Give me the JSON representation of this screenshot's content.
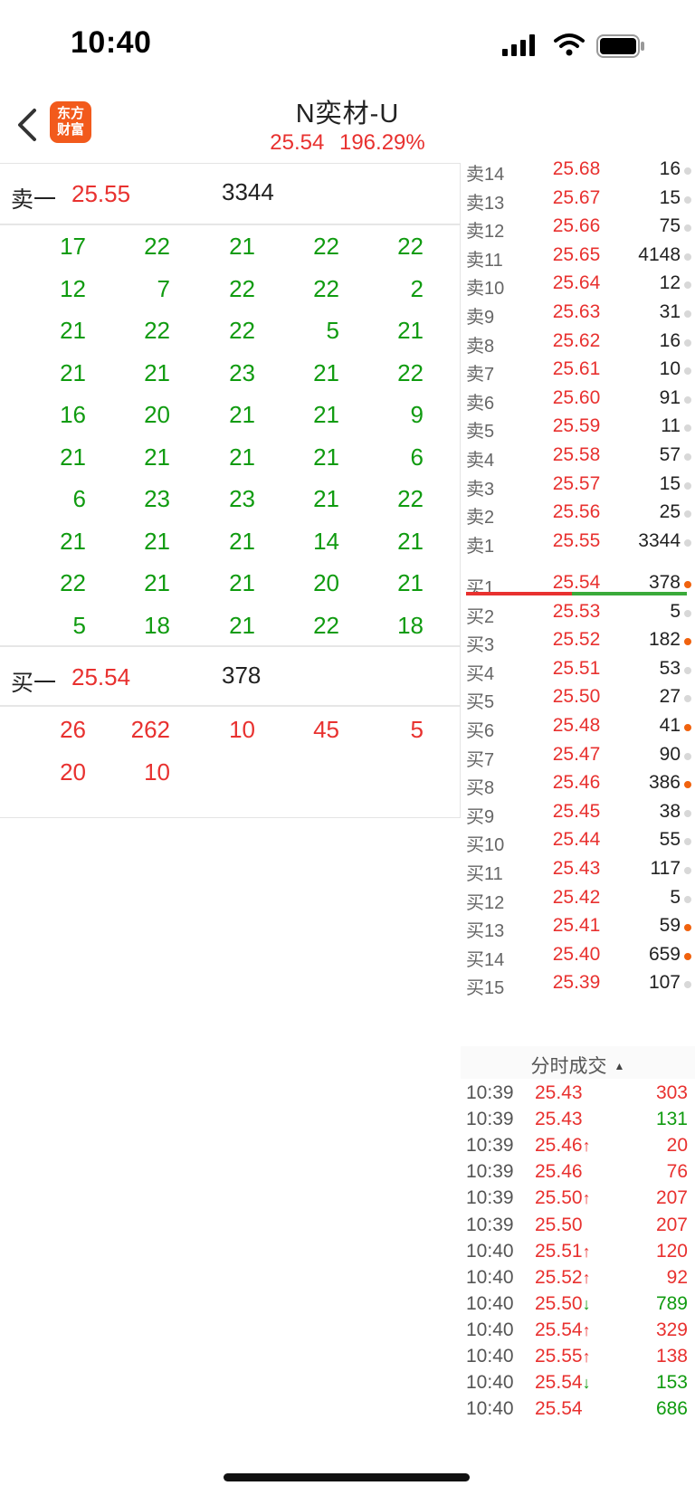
{
  "status_bar": {
    "time": "10:40"
  },
  "header": {
    "logo_line1": "东方",
    "logo_line2": "财富",
    "title": "N奕材-U",
    "price": "25.54",
    "change_pct": "196.29%"
  },
  "sell1": {
    "label": "卖一",
    "price": "25.55",
    "volume": "3344",
    "queue": [
      [
        "17",
        "22",
        "21",
        "22",
        "22"
      ],
      [
        "12",
        "7",
        "22",
        "22",
        "2"
      ],
      [
        "21",
        "22",
        "22",
        "5",
        "21"
      ],
      [
        "21",
        "21",
        "23",
        "21",
        "22"
      ],
      [
        "16",
        "20",
        "21",
        "21",
        "9"
      ],
      [
        "21",
        "21",
        "21",
        "21",
        "6"
      ],
      [
        "6",
        "23",
        "23",
        "21",
        "22"
      ],
      [
        "21",
        "21",
        "21",
        "14",
        "21"
      ],
      [
        "22",
        "21",
        "21",
        "20",
        "21"
      ],
      [
        "5",
        "18",
        "21",
        "22",
        "18"
      ]
    ]
  },
  "buy1": {
    "label": "买一",
    "price": "25.54",
    "volume": "378",
    "queue": [
      [
        "26",
        "262",
        "10",
        "45",
        "5"
      ],
      [
        "20",
        "10"
      ]
    ]
  },
  "order_book": {
    "asks": [
      {
        "label": "卖14",
        "price": "25.68",
        "volume": "16",
        "hot": false
      },
      {
        "label": "卖13",
        "price": "25.67",
        "volume": "15",
        "hot": false
      },
      {
        "label": "卖12",
        "price": "25.66",
        "volume": "75",
        "hot": false
      },
      {
        "label": "卖11",
        "price": "25.65",
        "volume": "4148",
        "hot": false
      },
      {
        "label": "卖10",
        "price": "25.64",
        "volume": "12",
        "hot": false
      },
      {
        "label": "卖9",
        "price": "25.63",
        "volume": "31",
        "hot": false
      },
      {
        "label": "卖8",
        "price": "25.62",
        "volume": "16",
        "hot": false
      },
      {
        "label": "卖7",
        "price": "25.61",
        "volume": "10",
        "hot": false
      },
      {
        "label": "卖6",
        "price": "25.60",
        "volume": "91",
        "hot": false
      },
      {
        "label": "卖5",
        "price": "25.59",
        "volume": "11",
        "hot": false
      },
      {
        "label": "卖4",
        "price": "25.58",
        "volume": "57",
        "hot": false
      },
      {
        "label": "卖3",
        "price": "25.57",
        "volume": "15",
        "hot": false
      },
      {
        "label": "卖2",
        "price": "25.56",
        "volume": "25",
        "hot": false
      },
      {
        "label": "卖1",
        "price": "25.55",
        "volume": "3344",
        "hot": false
      }
    ],
    "bids": [
      {
        "label": "买1",
        "price": "25.54",
        "volume": "378",
        "hot": true
      },
      {
        "label": "买2",
        "price": "25.53",
        "volume": "5",
        "hot": false
      },
      {
        "label": "买3",
        "price": "25.52",
        "volume": "182",
        "hot": true
      },
      {
        "label": "买4",
        "price": "25.51",
        "volume": "53",
        "hot": false
      },
      {
        "label": "买5",
        "price": "25.50",
        "volume": "27",
        "hot": false
      },
      {
        "label": "买6",
        "price": "25.48",
        "volume": "41",
        "hot": true
      },
      {
        "label": "买7",
        "price": "25.47",
        "volume": "90",
        "hot": false
      },
      {
        "label": "买8",
        "price": "25.46",
        "volume": "386",
        "hot": true
      },
      {
        "label": "买9",
        "price": "25.45",
        "volume": "38",
        "hot": false
      },
      {
        "label": "买10",
        "price": "25.44",
        "volume": "55",
        "hot": false
      },
      {
        "label": "买11",
        "price": "25.43",
        "volume": "117",
        "hot": false
      },
      {
        "label": "买12",
        "price": "25.42",
        "volume": "5",
        "hot": false
      },
      {
        "label": "买13",
        "price": "25.41",
        "volume": "59",
        "hot": true
      },
      {
        "label": "买14",
        "price": "25.40",
        "volume": "659",
        "hot": true
      },
      {
        "label": "买15",
        "price": "25.39",
        "volume": "107",
        "hot": false
      }
    ],
    "ask_bid_ratio": 0.48
  },
  "ticks": {
    "header": "分时成交",
    "rows": [
      {
        "time": "10:39",
        "price": "25.43",
        "arrow": "",
        "volume": "303",
        "dir": "buy"
      },
      {
        "time": "10:39",
        "price": "25.43",
        "arrow": "",
        "volume": "131",
        "dir": "sell"
      },
      {
        "time": "10:39",
        "price": "25.46",
        "arrow": "↑",
        "volume": "20",
        "dir": "buy"
      },
      {
        "time": "10:39",
        "price": "25.46",
        "arrow": "",
        "volume": "76",
        "dir": "buy"
      },
      {
        "time": "10:39",
        "price": "25.50",
        "arrow": "↑",
        "volume": "207",
        "dir": "buy"
      },
      {
        "time": "10:39",
        "price": "25.50",
        "arrow": "",
        "volume": "207",
        "dir": "buy"
      },
      {
        "time": "10:40",
        "price": "25.51",
        "arrow": "↑",
        "volume": "120",
        "dir": "buy"
      },
      {
        "time": "10:40",
        "price": "25.52",
        "arrow": "↑",
        "volume": "92",
        "dir": "buy"
      },
      {
        "time": "10:40",
        "price": "25.50",
        "arrow": "↓",
        "volume": "789",
        "dir": "sell"
      },
      {
        "time": "10:40",
        "price": "25.54",
        "arrow": "↑",
        "volume": "329",
        "dir": "buy"
      },
      {
        "time": "10:40",
        "price": "25.55",
        "arrow": "↑",
        "volume": "138",
        "dir": "buy"
      },
      {
        "time": "10:40",
        "price": "25.54",
        "arrow": "↓",
        "volume": "153",
        "dir": "sell"
      },
      {
        "time": "10:40",
        "price": "25.54",
        "arrow": "",
        "volume": "686",
        "dir": "sell"
      }
    ]
  },
  "colors": {
    "up": "#e8312f",
    "down": "#109b10",
    "hot_dot": "#f0620e",
    "logo": "#f25a1c"
  }
}
